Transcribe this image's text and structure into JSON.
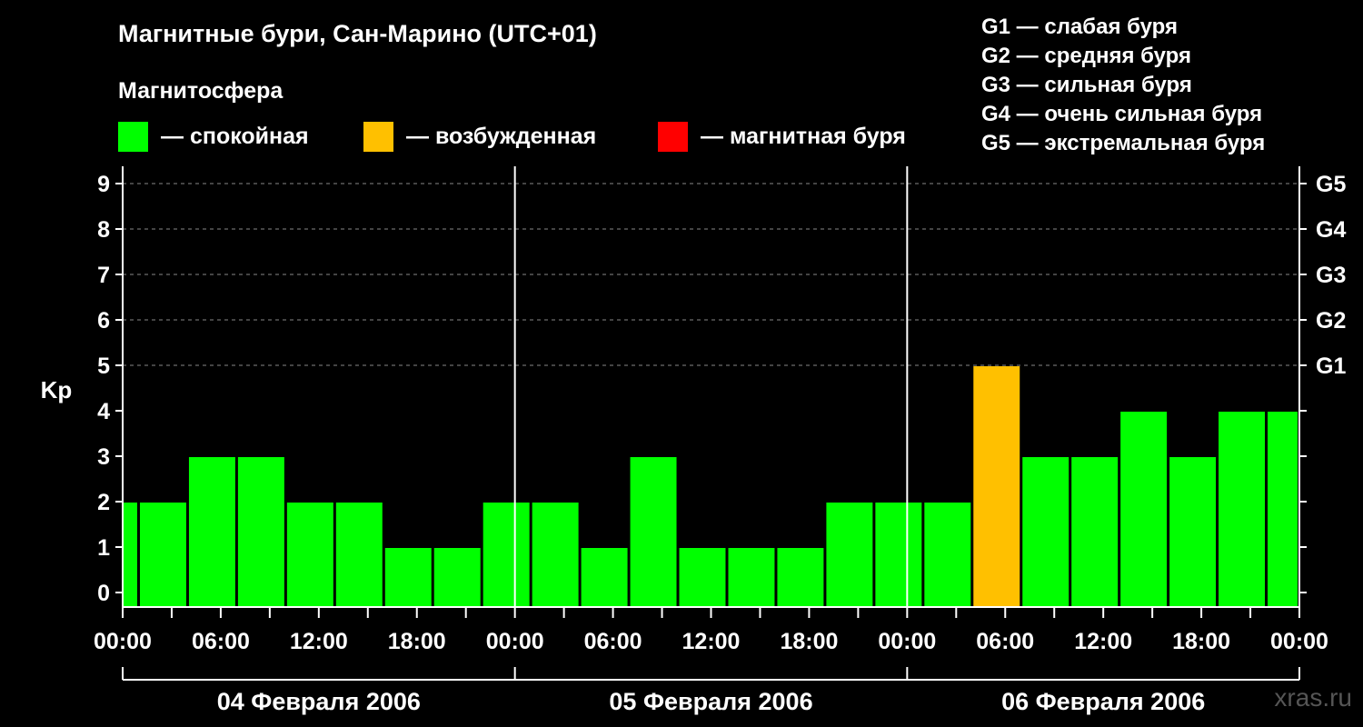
{
  "title": "Магнитные бури, Сан-Марино (UTC+01)",
  "subtitle": "Магнитосфера",
  "legend": [
    {
      "label": "— спокойная",
      "color": "#00ff00"
    },
    {
      "label": "— возбужденная",
      "color": "#ffc000"
    },
    {
      "label": "— магнитная буря",
      "color": "#ff0000"
    }
  ],
  "storm_levels": [
    "G1 — слабая буря",
    "G2 — средняя буря",
    "G3 — сильная буря",
    "G4 — очень сильная буря",
    "G5 — экстремальная буря"
  ],
  "watermark": "xras.ru",
  "chart_data": {
    "type": "bar",
    "ylabel": "Kp",
    "ylim": [
      0,
      9
    ],
    "y_ticks": [
      0,
      1,
      2,
      3,
      4,
      5,
      6,
      7,
      8,
      9
    ],
    "right_ticks": [
      {
        "value": 5,
        "label": "G1"
      },
      {
        "value": 6,
        "label": "G2"
      },
      {
        "value": 7,
        "label": "G3"
      },
      {
        "value": 8,
        "label": "G4"
      },
      {
        "value": 9,
        "label": "G5"
      }
    ],
    "grid": "dashed horizontal at Kp 5–9",
    "x_range_hours": [
      0,
      72
    ],
    "x_tick_labels": [
      "00:00",
      "06:00",
      "12:00",
      "18:00",
      "00:00",
      "06:00",
      "12:00",
      "18:00",
      "00:00",
      "06:00",
      "12:00",
      "18:00",
      "00:00"
    ],
    "days": [
      "04 Февраля 2006",
      "05 Февраля 2006",
      "06 Февраля 2006"
    ],
    "colors": {
      "quiet": "#00ff00",
      "active": "#ffc000",
      "storm": "#ff0000"
    },
    "bars": [
      {
        "start": 0,
        "end": 1,
        "kp": 1,
        "level": "quiet"
      },
      {
        "start": 1,
        "end": 4,
        "kp": 1,
        "level": "quiet"
      },
      {
        "start": 4,
        "end": 7,
        "kp": 2,
        "level": "quiet"
      },
      {
        "start": 7,
        "end": 10,
        "kp": 2,
        "level": "quiet"
      },
      {
        "start": 10,
        "end": 13,
        "kp": 1,
        "level": "quiet"
      },
      {
        "start": 13,
        "end": 16,
        "kp": 1,
        "level": "quiet"
      },
      {
        "start": 16,
        "end": 19,
        "kp": 0,
        "level": "quiet"
      },
      {
        "start": 19,
        "end": 22,
        "kp": 0,
        "level": "quiet"
      },
      {
        "start": 22,
        "end": 25,
        "kp": 1,
        "level": "quiet"
      },
      {
        "start": 25,
        "end": 28,
        "kp": 1,
        "level": "quiet"
      },
      {
        "start": 28,
        "end": 31,
        "kp": 0,
        "level": "quiet"
      },
      {
        "start": 31,
        "end": 34,
        "kp": 2,
        "level": "quiet"
      },
      {
        "start": 34,
        "end": 37,
        "kp": 0,
        "level": "quiet"
      },
      {
        "start": 37,
        "end": 40,
        "kp": 0,
        "level": "quiet"
      },
      {
        "start": 40,
        "end": 43,
        "kp": 0,
        "level": "quiet"
      },
      {
        "start": 43,
        "end": 46,
        "kp": 1,
        "level": "quiet"
      },
      {
        "start": 46,
        "end": 49,
        "kp": 1,
        "level": "quiet"
      },
      {
        "start": 49,
        "end": 52,
        "kp": 1,
        "level": "quiet"
      },
      {
        "start": 52,
        "end": 55,
        "kp": 4,
        "level": "active"
      },
      {
        "start": 55,
        "end": 58,
        "kp": 2,
        "level": "quiet"
      },
      {
        "start": 58,
        "end": 61,
        "kp": 2,
        "level": "quiet"
      },
      {
        "start": 61,
        "end": 64,
        "kp": 3,
        "level": "quiet"
      },
      {
        "start": 64,
        "end": 67,
        "kp": 2,
        "level": "quiet"
      },
      {
        "start": 67,
        "end": 70,
        "kp": 3,
        "level": "quiet"
      },
      {
        "start": 70,
        "end": 72,
        "kp": 3,
        "level": "quiet"
      }
    ]
  }
}
